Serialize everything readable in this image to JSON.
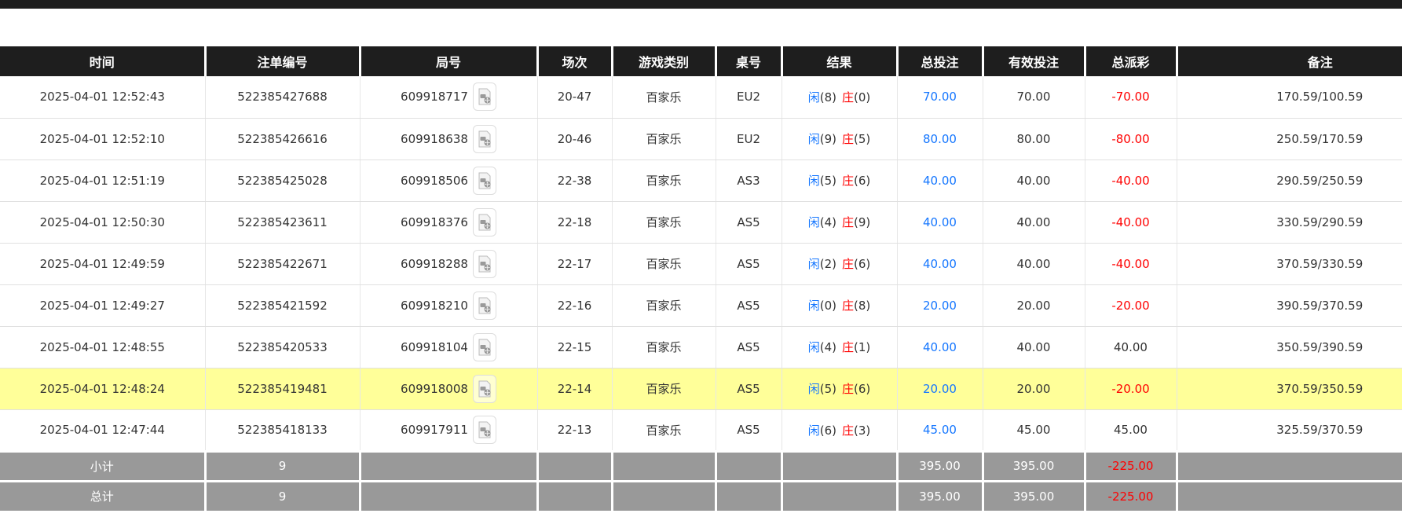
{
  "colors": {
    "header_bg": "#1e1e1e",
    "header_text": "#ffffff",
    "accent_blue": "#1677ff",
    "accent_red": "#ff0000",
    "highlight_yellow": "#ffff99",
    "summary_bg": "#999999",
    "body_text": "#333333"
  },
  "icons": {
    "video": "video-replay-file-icon"
  },
  "labels": {
    "player": "闲",
    "banker": "庄"
  },
  "table": {
    "headers": [
      "时间",
      "注单编号",
      "局号",
      "场次",
      "游戏类别",
      "桌号",
      "结果",
      "总投注",
      "有效投注",
      "总派彩",
      "备注"
    ],
    "rows": [
      {
        "time": "2025-04-01 12:52:43",
        "bet_id": "522385427688",
        "round_id": "609918717",
        "session": "20-47",
        "game": "百家乐",
        "table_no": "EU2",
        "result_player": "(8)",
        "result_banker": "(0)",
        "total_bet": "70.00",
        "valid_bet": "70.00",
        "payout": "-70.00",
        "remark": "170.59/100.59"
      },
      {
        "time": "2025-04-01 12:52:10",
        "bet_id": "522385426616",
        "round_id": "609918638",
        "session": "20-46",
        "game": "百家乐",
        "table_no": "EU2",
        "result_player": "(9)",
        "result_banker": "(5)",
        "total_bet": "80.00",
        "valid_bet": "80.00",
        "payout": "-80.00",
        "remark": "250.59/170.59"
      },
      {
        "time": "2025-04-01 12:51:19",
        "bet_id": "522385425028",
        "round_id": "609918506",
        "session": "22-38",
        "game": "百家乐",
        "table_no": "AS3",
        "result_player": "(5)",
        "result_banker": "(6)",
        "total_bet": "40.00",
        "valid_bet": "40.00",
        "payout": "-40.00",
        "remark": "290.59/250.59"
      },
      {
        "time": "2025-04-01 12:50:30",
        "bet_id": "522385423611",
        "round_id": "609918376",
        "session": "22-18",
        "game": "百家乐",
        "table_no": "AS5",
        "result_player": "(4)",
        "result_banker": "(9)",
        "total_bet": "40.00",
        "valid_bet": "40.00",
        "payout": "-40.00",
        "remark": "330.59/290.59"
      },
      {
        "time": "2025-04-01 12:49:59",
        "bet_id": "522385422671",
        "round_id": "609918288",
        "session": "22-17",
        "game": "百家乐",
        "table_no": "AS5",
        "result_player": "(2)",
        "result_banker": "(6)",
        "total_bet": "40.00",
        "valid_bet": "40.00",
        "payout": "-40.00",
        "remark": "370.59/330.59"
      },
      {
        "time": "2025-04-01 12:49:27",
        "bet_id": "522385421592",
        "round_id": "609918210",
        "session": "22-16",
        "game": "百家乐",
        "table_no": "AS5",
        "result_player": "(0)",
        "result_banker": "(8)",
        "total_bet": "20.00",
        "valid_bet": "20.00",
        "payout": "-20.00",
        "remark": "390.59/370.59"
      },
      {
        "time": "2025-04-01 12:48:55",
        "bet_id": "522385420533",
        "round_id": "609918104",
        "session": "22-15",
        "game": "百家乐",
        "table_no": "AS5",
        "result_player": "(4)",
        "result_banker": "(1)",
        "total_bet": "40.00",
        "valid_bet": "40.00",
        "payout": "40.00",
        "remark": "350.59/390.59"
      },
      {
        "time": "2025-04-01 12:48:24",
        "bet_id": "522385419481",
        "round_id": "609918008",
        "session": "22-14",
        "game": "百家乐",
        "table_no": "AS5",
        "result_player": "(5)",
        "result_banker": "(6)",
        "total_bet": "20.00",
        "valid_bet": "20.00",
        "payout": "-20.00",
        "remark": "370.59/350.59"
      },
      {
        "time": "2025-04-01 12:47:44",
        "bet_id": "522385418133",
        "round_id": "609917911",
        "session": "22-13",
        "game": "百家乐",
        "table_no": "AS5",
        "result_player": "(6)",
        "result_banker": "(3)",
        "total_bet": "45.00",
        "valid_bet": "45.00",
        "payout": "45.00",
        "remark": "325.59/370.59"
      }
    ],
    "summary": [
      {
        "label": "小计",
        "count": "9",
        "total_bet": "395.00",
        "valid_bet": "395.00",
        "payout": "-225.00"
      },
      {
        "label": "总计",
        "count": "9",
        "total_bet": "395.00",
        "valid_bet": "395.00",
        "payout": "-225.00"
      }
    ]
  }
}
